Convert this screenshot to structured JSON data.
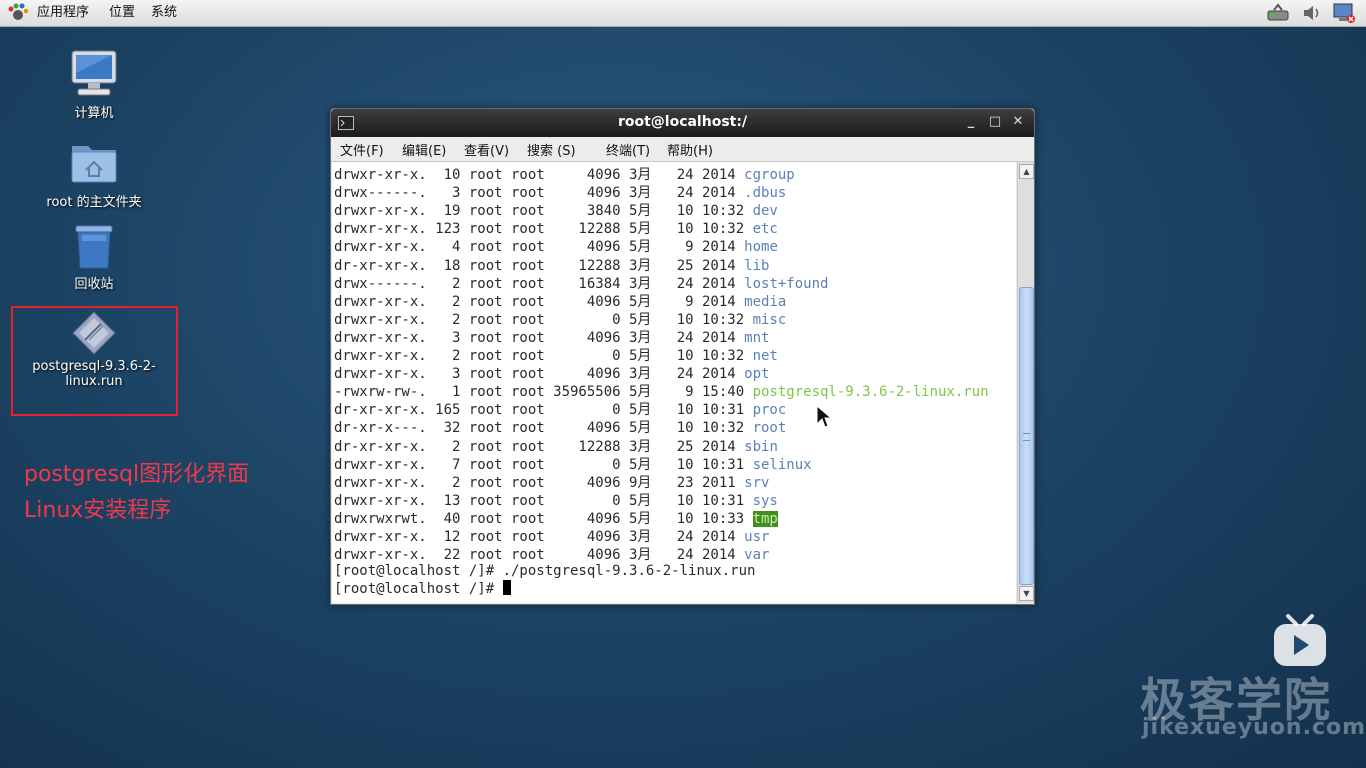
{
  "panel": {
    "menus": [
      "应用程序",
      "位置",
      "系统"
    ],
    "icons": [
      "gnome-foot-icon",
      "network-icon",
      "volume-icon",
      "display-icon"
    ]
  },
  "desktop": {
    "icons": [
      {
        "label": "计算机",
        "icon": "computer-icon"
      },
      {
        "label": "root 的主文件夹",
        "icon": "home-folder-icon"
      },
      {
        "label": "回收站",
        "icon": "trash-icon"
      },
      {
        "label_line1": "postgresql-9.3.6-2-",
        "label_line2": "linux.run",
        "icon": "installer-file-icon"
      }
    ],
    "annotation": {
      "line1": "postgresql图形化界面",
      "line2": "Linux安装程序",
      "color": "#f0384a"
    }
  },
  "terminal": {
    "title": "root@localhost:/",
    "buttons": {
      "minimize": "_",
      "maximize": "□",
      "close": "✕"
    },
    "menu": [
      "文件(F)",
      "编辑(E)",
      "查看(V)",
      "搜索 (S)",
      "终端(T)",
      "帮助(H)"
    ],
    "rows": [
      {
        "meta": "drwxr-xr-x.  10 root root     4096 3月   24 2014 ",
        "name": "cgroup",
        "kind": "dir"
      },
      {
        "meta": "drwx------.   3 root root     4096 3月   24 2014 ",
        "name": ".dbus",
        "kind": "dir"
      },
      {
        "meta": "drwxr-xr-x.  19 root root     3840 5月   10 10:32 ",
        "name": "dev",
        "kind": "dir"
      },
      {
        "meta": "drwxr-xr-x. 123 root root    12288 5月   10 10:32 ",
        "name": "etc",
        "kind": "dir"
      },
      {
        "meta": "drwxr-xr-x.   4 root root     4096 5月    9 2014 ",
        "name": "home",
        "kind": "dir"
      },
      {
        "meta": "dr-xr-xr-x.  18 root root    12288 3月   25 2014 ",
        "name": "lib",
        "kind": "dir"
      },
      {
        "meta": "drwx------.   2 root root    16384 3月   24 2014 ",
        "name": "lost+found",
        "kind": "dir"
      },
      {
        "meta": "drwxr-xr-x.   2 root root     4096 5月    9 2014 ",
        "name": "media",
        "kind": "dir"
      },
      {
        "meta": "drwxr-xr-x.   2 root root        0 5月   10 10:32 ",
        "name": "misc",
        "kind": "dir"
      },
      {
        "meta": "drwxr-xr-x.   3 root root     4096 3月   24 2014 ",
        "name": "mnt",
        "kind": "dir"
      },
      {
        "meta": "drwxr-xr-x.   2 root root        0 5月   10 10:32 ",
        "name": "net",
        "kind": "dir"
      },
      {
        "meta": "drwxr-xr-x.   3 root root     4096 3月   24 2014 ",
        "name": "opt",
        "kind": "dir"
      },
      {
        "meta": "-rwxrw-rw-.   1 root root 35965506 5月    9 15:40 ",
        "name": "postgresql-9.3.6-2-linux.run",
        "kind": "exec"
      },
      {
        "meta": "dr-xr-xr-x. 165 root root        0 5月   10 10:31 ",
        "name": "proc",
        "kind": "dir"
      },
      {
        "meta": "dr-xr-x---.  32 root root     4096 5月   10 10:32 ",
        "name": "root",
        "kind": "dir"
      },
      {
        "meta": "dr-xr-xr-x.   2 root root    12288 3月   25 2014 ",
        "name": "sbin",
        "kind": "dir"
      },
      {
        "meta": "drwxr-xr-x.   7 root root        0 5月   10 10:31 ",
        "name": "selinux",
        "kind": "dir"
      },
      {
        "meta": "drwxr-xr-x.   2 root root     4096 9月   23 2011 ",
        "name": "srv",
        "kind": "dir"
      },
      {
        "meta": "drwxr-xr-x.  13 root root        0 5月   10 10:31 ",
        "name": "sys",
        "kind": "dir"
      },
      {
        "meta": "drwxrwxrwt.  40 root root     4096 5月   10 10:33 ",
        "name": "tmp",
        "kind": "tmp"
      },
      {
        "meta": "drwxr-xr-x.  12 root root     4096 3月   24 2014 ",
        "name": "usr",
        "kind": "dir"
      },
      {
        "meta": "drwxr-xr-x.  22 root root     4096 3月   24 2014 ",
        "name": "var",
        "kind": "dir"
      }
    ],
    "cmd_prompt": "[root@localhost /]# ",
    "cmd": "./postgresql-9.3.6-2-linux.run",
    "current_prompt": "[root@localhost /]# ",
    "scroll_position": 0.27,
    "colors": {
      "dir": "#5b7fb8",
      "exec": "#7dc745",
      "tmp_bg": "#3e8f1b"
    }
  },
  "watermark": {
    "title": "极客学院",
    "url": "jikexueyuon.com",
    "icon": "tv-play-icon"
  }
}
